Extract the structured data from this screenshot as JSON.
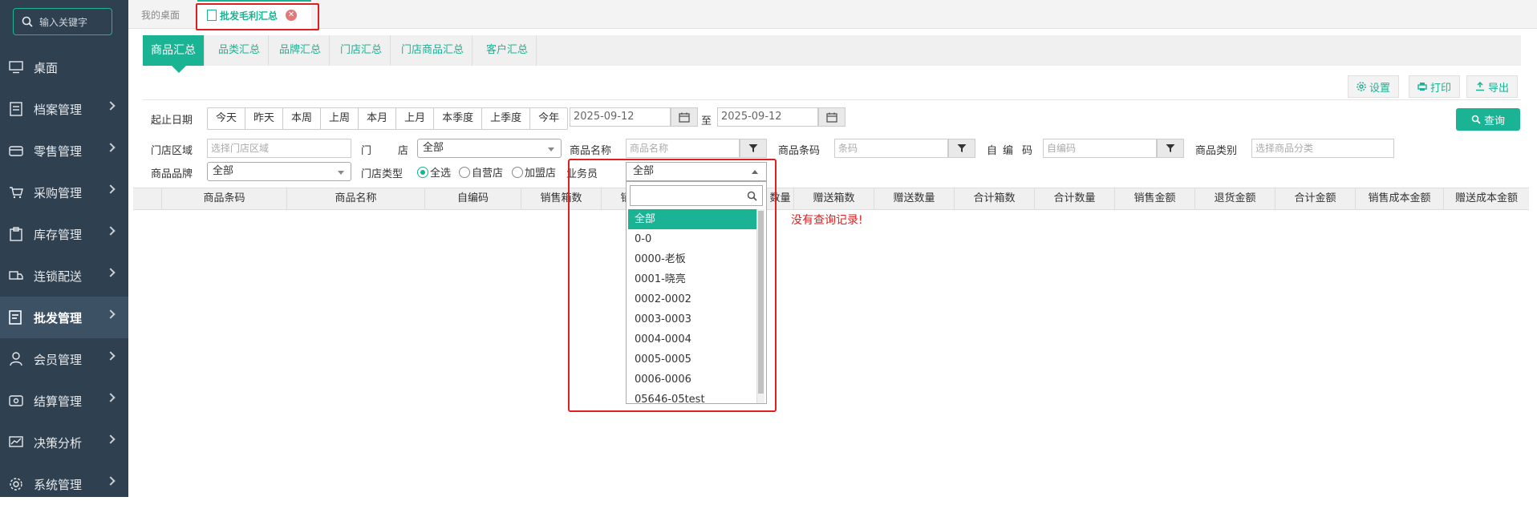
{
  "search": {
    "placeholder": "输入关键字"
  },
  "sidebar": {
    "items": [
      {
        "label": "桌面"
      },
      {
        "label": "档案管理"
      },
      {
        "label": "零售管理"
      },
      {
        "label": "采购管理"
      },
      {
        "label": "库存管理"
      },
      {
        "label": "连锁配送"
      },
      {
        "label": "批发管理"
      },
      {
        "label": "会员管理"
      },
      {
        "label": "结算管理"
      },
      {
        "label": "决策分析"
      },
      {
        "label": "系统管理"
      }
    ]
  },
  "tabs": {
    "home": "我的桌面",
    "active": "批发毛利汇总"
  },
  "subtabs": [
    "商品汇总",
    "品类汇总",
    "品牌汇总",
    "门店汇总",
    "门店商品汇总",
    "客户汇总"
  ],
  "toolbar": {
    "settings": "设置",
    "print": "打印",
    "export": "导出"
  },
  "filters": {
    "date_label": "起止日期",
    "date_buttons": [
      "今天",
      "昨天",
      "本周",
      "上周",
      "本月",
      "上月",
      "本季度",
      "上季度",
      "今年"
    ],
    "start_date": "2025-09-12",
    "to": "至",
    "end_date": "2025-09-12",
    "query": "查询",
    "store_area_label": "门店区域",
    "store_area_placeholder": "选择门店区域",
    "store_label_1": "门",
    "store_label_2": "店",
    "store_value": "全部",
    "product_name_label": "商品名称",
    "product_name_placeholder": "商品名称",
    "barcode_label": "商品条码",
    "barcode_placeholder": "条码",
    "selfcode_label_1": "自",
    "selfcode_label_2": "编",
    "selfcode_label_3": "码",
    "selfcode_placeholder": "自编码",
    "category_label": "商品类别",
    "category_placeholder": "选择商品分类",
    "brand_label": "商品品牌",
    "brand_value": "全部",
    "store_type_label": "门店类型",
    "store_types": [
      "全选",
      "自营店",
      "加盟店"
    ],
    "salesman_label": "业务员",
    "salesman_value": "全部"
  },
  "table": {
    "headers": [
      "商品条码",
      "商品名称",
      "自编码",
      "销售箱数",
      "销售数量",
      "数量",
      "赠送箱数",
      "赠送数量",
      "合计箱数",
      "合计数量",
      "销售金额",
      "退货金额",
      "合计金额",
      "销售成本金额",
      "赠送成本金额"
    ],
    "empty_message": "没有查询记录!"
  },
  "dropdown": {
    "options": [
      "全部",
      "0-0",
      "0000-老板",
      "0001-晓亮",
      "0002-0002",
      "0003-0003",
      "0004-0004",
      "0005-0005",
      "0006-0006",
      "05646-05test"
    ]
  }
}
